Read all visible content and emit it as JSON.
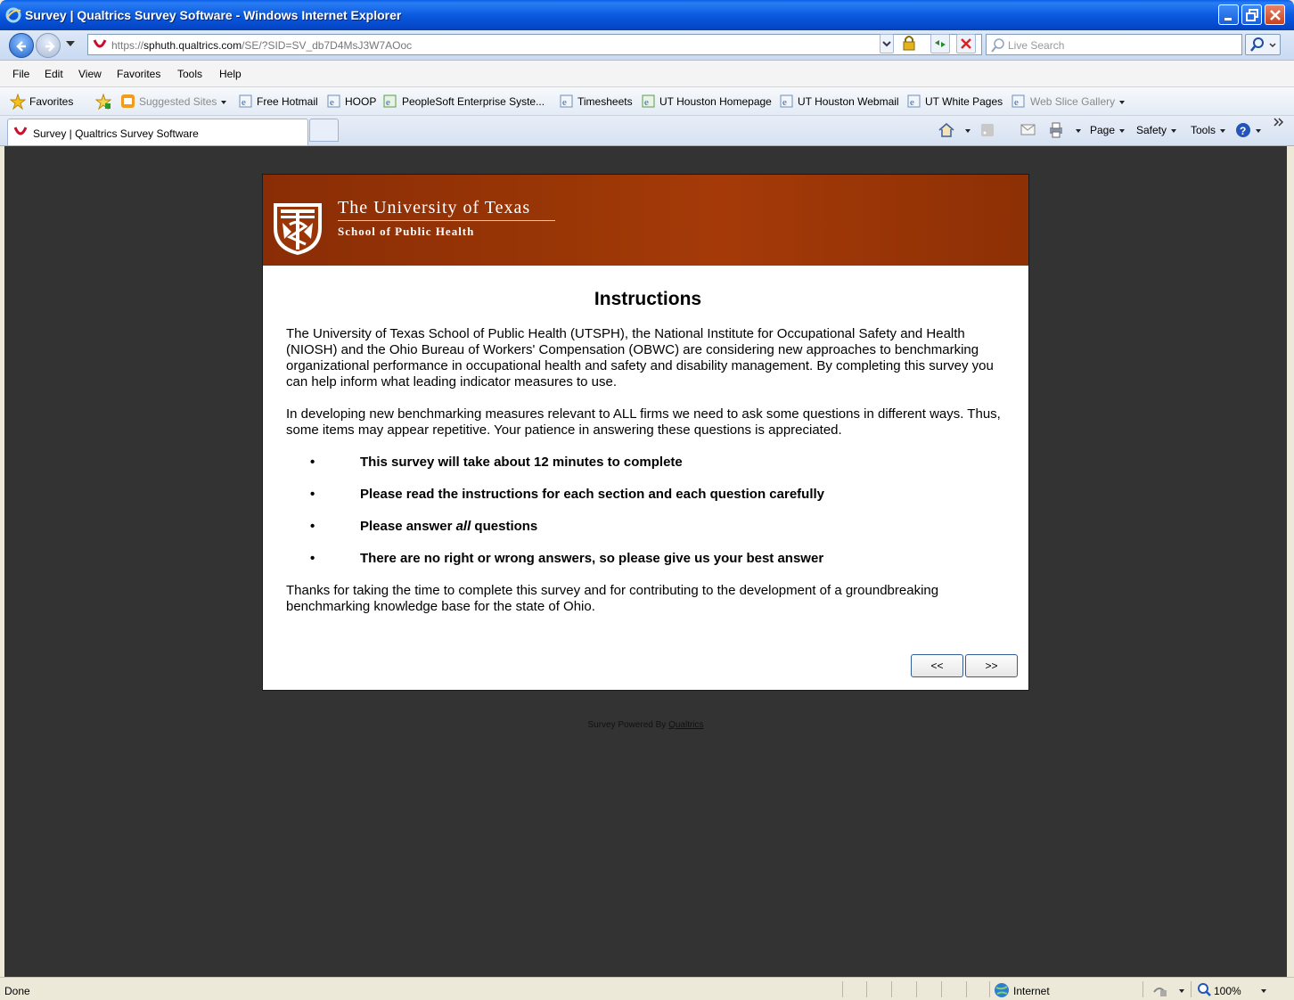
{
  "window": {
    "title": "Survey | Qualtrics Survey Software - Windows Internet Explorer"
  },
  "address_bar": {
    "url_prefix": "https://",
    "url_host": "sphuth.qualtrics.com",
    "url_path": "/SE/?SID=SV_db7D4MsJ3W7AOoc",
    "search_placeholder": "Live Search"
  },
  "menu": [
    "File",
    "Edit",
    "View",
    "Favorites",
    "Tools",
    "Help"
  ],
  "favorites_bar": {
    "favorites_label": "Favorites",
    "suggested_sites": "Suggested Sites",
    "links": [
      "Free Hotmail",
      "HOOP",
      "PeopleSoft Enterprise Syste...",
      "Timesheets",
      "UT Houston Homepage",
      "UT Houston Webmail",
      "UT White Pages"
    ],
    "web_slice": "Web Slice Gallery"
  },
  "tab": {
    "label": "Survey | Qualtrics Survey Software"
  },
  "command_bar": {
    "page": "Page",
    "safety": "Safety",
    "tools": "Tools"
  },
  "banner": {
    "university": "The University of Texas",
    "school": "School of Public Health"
  },
  "survey": {
    "heading": "Instructions",
    "para1": "The University of Texas School of Public Health (UTSPH), the National Institute for Occupational Safety and Health (NIOSH) and the Ohio Bureau of Workers' Compensation (OBWC) are considering new approaches to benchmarking organizational performance in occupational health and safety and disability management. By completing this survey you can help inform what leading indicator measures to use.",
    "para2": "In developing new benchmarking measures relevant to ALL firms we need to ask some questions in different ways. Thus, some items may appear repetitive. Your patience in answering these questions is appreciated.",
    "bullet_char": "•",
    "bullet1": "This survey will take about 12 minutes to complete",
    "bullet2": "Please read the instructions for each section and each question carefully",
    "bullet3_before": "Please answer ",
    "bullet3_em": "all",
    "bullet3_after": " questions",
    "bullet4": "There are no right or wrong answers, so please give us your best answer",
    "para3": "Thanks for taking the time to complete this survey and for contributing to the development of a groundbreaking benchmarking knowledge base for the state of Ohio.",
    "back_button": "<<",
    "next_button": ">>"
  },
  "footer": {
    "powered_text": "Survey Powered By ",
    "powered_link": "Qualtrics"
  },
  "status_bar": {
    "status": "Done",
    "zone": "Internet",
    "zoom": "100%"
  },
  "colors": {
    "title_bar": "#0a5ae0",
    "banner": "#9a3606",
    "page_background": "#333333"
  }
}
